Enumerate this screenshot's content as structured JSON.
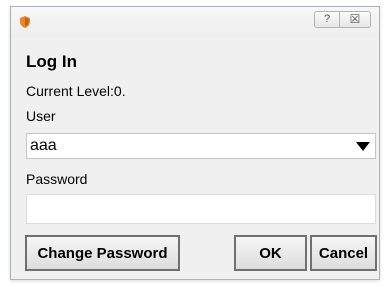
{
  "window": {
    "help_glyph": "?",
    "close_glyph": "☒",
    "icon": "shield-icon",
    "icon_color": "#e8862a"
  },
  "login": {
    "heading": "Log In",
    "current_level": "Current Level:0.",
    "user_label": "User",
    "user_value": "aaa",
    "password_label": "Password",
    "password_value": ""
  },
  "buttons": {
    "change_password": "Change Password",
    "ok": "OK",
    "cancel": "Cancel"
  }
}
